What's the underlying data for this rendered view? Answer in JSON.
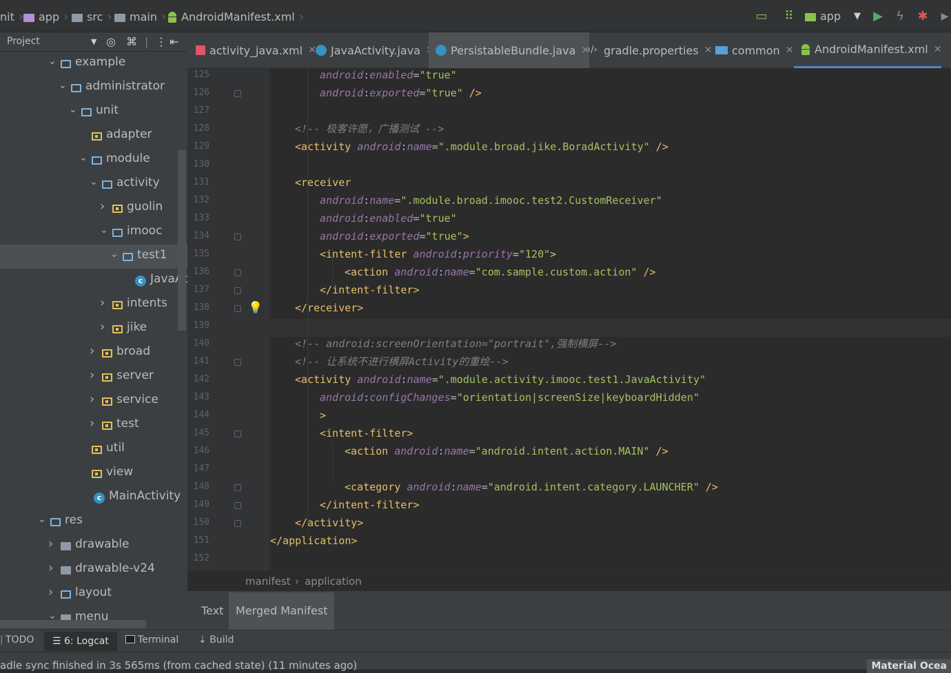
{
  "breadcrumbs": [
    "nit",
    "app",
    "src",
    "main",
    "AndroidManifest.xml"
  ],
  "toolbar": {
    "run_config": "app",
    "icons": [
      "sync-icon",
      "structure-icon",
      "run-config-icon",
      "dropdown-icon",
      "run-icon",
      "apply-changes-icon",
      "debug-icon",
      "attach-icon"
    ]
  },
  "project_panel": {
    "label": "Project",
    "tree": [
      {
        "label": "example",
        "depth": 0,
        "expanded": true,
        "kind": "folder"
      },
      {
        "label": "administrator",
        "depth": 1,
        "expanded": true,
        "kind": "folder"
      },
      {
        "label": "unit",
        "depth": 2,
        "expanded": true,
        "kind": "folder"
      },
      {
        "label": "adapter",
        "depth": 3,
        "expanded": null,
        "kind": "package"
      },
      {
        "label": "module",
        "depth": 3,
        "expanded": true,
        "kind": "folder"
      },
      {
        "label": "activity",
        "depth": 4,
        "expanded": true,
        "kind": "folder"
      },
      {
        "label": "guolin",
        "depth": 5,
        "expanded": false,
        "kind": "package"
      },
      {
        "label": "imooc",
        "depth": 5,
        "expanded": true,
        "kind": "folder"
      },
      {
        "label": "test1",
        "depth": 6,
        "expanded": true,
        "kind": "folder",
        "selected": true
      },
      {
        "label": "JavaAct",
        "depth": 7,
        "expanded": null,
        "kind": "class"
      },
      {
        "label": "intents",
        "depth": 5,
        "expanded": false,
        "kind": "package"
      },
      {
        "label": "jike",
        "depth": 5,
        "expanded": false,
        "kind": "package"
      },
      {
        "label": "broad",
        "depth": 4,
        "expanded": false,
        "kind": "package"
      },
      {
        "label": "server",
        "depth": 4,
        "expanded": false,
        "kind": "package"
      },
      {
        "label": "service",
        "depth": 4,
        "expanded": false,
        "kind": "package"
      },
      {
        "label": "test",
        "depth": 4,
        "expanded": false,
        "kind": "package"
      },
      {
        "label": "util",
        "depth": 3,
        "expanded": null,
        "kind": "package"
      },
      {
        "label": "view",
        "depth": 3,
        "expanded": null,
        "kind": "package"
      },
      {
        "label": "MainActivity",
        "depth": 3,
        "expanded": null,
        "kind": "class"
      },
      {
        "label": "res",
        "depth": -1,
        "expanded": true,
        "kind": "folder"
      },
      {
        "label": "drawable",
        "depth": 0,
        "expanded": false,
        "kind": "res"
      },
      {
        "label": "drawable-v24",
        "depth": 0,
        "expanded": false,
        "kind": "res"
      },
      {
        "label": "layout",
        "depth": 0,
        "expanded": false,
        "kind": "folder"
      },
      {
        "label": "menu",
        "depth": 0,
        "expanded": true,
        "kind": "res"
      }
    ]
  },
  "tabs": [
    {
      "label": "activity_java.xml",
      "icon": "xml-layout-icon"
    },
    {
      "label": "JavaActivity.java",
      "icon": "class-icon"
    },
    {
      "label": "PersistableBundle.java",
      "icon": "class-icon",
      "active": true
    },
    {
      "label": "gradle.properties",
      "icon": "properties-icon"
    },
    {
      "label": "common",
      "icon": "module-icon"
    },
    {
      "label": "AndroidManifest.xml",
      "icon": "android-icon",
      "current": true
    }
  ],
  "editor": {
    "lines": [
      {
        "n": "125",
        "indent": 2,
        "tokens": [
          [
            "ns",
            "android"
          ],
          [
            "attr",
            ":"
          ],
          [
            "ns",
            "enabled"
          ],
          [
            "attr",
            "="
          ],
          [
            "str",
            "\"true\""
          ]
        ]
      },
      {
        "n": "126",
        "indent": 2,
        "tokens": [
          [
            "ns",
            "android"
          ],
          [
            "attr",
            ":"
          ],
          [
            "ns",
            "exported"
          ],
          [
            "attr",
            "="
          ],
          [
            "str",
            "\"true\""
          ],
          [
            "plain",
            " "
          ],
          [
            "tag",
            "/>"
          ]
        ]
      },
      {
        "n": "127",
        "indent": 0,
        "tokens": []
      },
      {
        "n": "128",
        "indent": 1,
        "tokens": [
          [
            "com",
            "<!-- 极客许愿，广播测试 -->"
          ]
        ]
      },
      {
        "n": "129",
        "indent": 1,
        "tokens": [
          [
            "tag",
            "<activity "
          ],
          [
            "ns",
            "android"
          ],
          [
            "attr",
            ":"
          ],
          [
            "ns",
            "name"
          ],
          [
            "attr",
            "="
          ],
          [
            "str",
            "\".module.broad.jike.BoradActivity\""
          ],
          [
            "plain",
            " "
          ],
          [
            "tag",
            "/>"
          ]
        ]
      },
      {
        "n": "130",
        "indent": 0,
        "tokens": []
      },
      {
        "n": "131",
        "indent": 1,
        "tokens": [
          [
            "tag",
            "<receiver"
          ]
        ]
      },
      {
        "n": "132",
        "indent": 2,
        "tokens": [
          [
            "ns",
            "android"
          ],
          [
            "attr",
            ":"
          ],
          [
            "ns",
            "name"
          ],
          [
            "attr",
            "="
          ],
          [
            "str",
            "\".module.broad.imooc.test2.CustomReceiver\""
          ]
        ]
      },
      {
        "n": "133",
        "indent": 2,
        "tokens": [
          [
            "ns",
            "android"
          ],
          [
            "attr",
            ":"
          ],
          [
            "ns",
            "enabled"
          ],
          [
            "attr",
            "="
          ],
          [
            "str",
            "\"true\""
          ]
        ]
      },
      {
        "n": "134",
        "indent": 2,
        "tokens": [
          [
            "ns",
            "android"
          ],
          [
            "attr",
            ":"
          ],
          [
            "ns",
            "exported"
          ],
          [
            "attr",
            "="
          ],
          [
            "str",
            "\"true\""
          ],
          [
            "tag",
            ">"
          ]
        ]
      },
      {
        "n": "135",
        "indent": 2,
        "tokens": [
          [
            "tag",
            "<intent-filter "
          ],
          [
            "ns",
            "android"
          ],
          [
            "attr",
            ":"
          ],
          [
            "ns",
            "priority"
          ],
          [
            "attr",
            "="
          ],
          [
            "str",
            "\"120\""
          ],
          [
            "tag",
            ">"
          ]
        ]
      },
      {
        "n": "136",
        "indent": 3,
        "tokens": [
          [
            "tag",
            "<action "
          ],
          [
            "ns",
            "android"
          ],
          [
            "attr",
            ":"
          ],
          [
            "ns",
            "name"
          ],
          [
            "attr",
            "="
          ],
          [
            "str",
            "\"com.sample.custom.action\""
          ],
          [
            "plain",
            " "
          ],
          [
            "tag",
            "/>"
          ]
        ]
      },
      {
        "n": "137",
        "indent": 2,
        "tokens": [
          [
            "tag",
            "</intent-filter>"
          ]
        ]
      },
      {
        "n": "138",
        "indent": 1,
        "tokens": [
          [
            "tag",
            "</receiver>"
          ]
        ]
      },
      {
        "n": "139",
        "indent": 0,
        "tokens": [],
        "current": true
      },
      {
        "n": "140",
        "indent": 1,
        "tokens": [
          [
            "com",
            "<!-- android:screenOrientation=\"portrait\",强制横屏-->"
          ]
        ]
      },
      {
        "n": "141",
        "indent": 1,
        "tokens": [
          [
            "com",
            "<!-- 让系统不进行横屏Activity的重绘-->"
          ]
        ]
      },
      {
        "n": "142",
        "indent": 1,
        "tokens": [
          [
            "tag",
            "<activity "
          ],
          [
            "ns",
            "android"
          ],
          [
            "attr",
            ":"
          ],
          [
            "ns",
            "name"
          ],
          [
            "attr",
            "="
          ],
          [
            "str",
            "\".module.activity.imooc.test1.JavaActivity\""
          ]
        ]
      },
      {
        "n": "143",
        "indent": 2,
        "tokens": [
          [
            "ns",
            "android"
          ],
          [
            "attr",
            ":"
          ],
          [
            "ns",
            "configChanges"
          ],
          [
            "attr",
            "="
          ],
          [
            "str",
            "\"orientation|screenSize|keyboardHidden\""
          ]
        ]
      },
      {
        "n": "144",
        "indent": 2,
        "tokens": [
          [
            "tag",
            ">"
          ]
        ]
      },
      {
        "n": "145",
        "indent": 2,
        "tokens": [
          [
            "tag",
            "<intent-filter>"
          ]
        ]
      },
      {
        "n": "146",
        "indent": 3,
        "tokens": [
          [
            "tag",
            "<action "
          ],
          [
            "ns",
            "android"
          ],
          [
            "attr",
            ":"
          ],
          [
            "ns",
            "name"
          ],
          [
            "attr",
            "="
          ],
          [
            "str",
            "\"android.intent.action.MAIN\""
          ],
          [
            "plain",
            " "
          ],
          [
            "tag",
            "/>"
          ]
        ]
      },
      {
        "n": "147",
        "indent": 0,
        "tokens": []
      },
      {
        "n": "148",
        "indent": 3,
        "tokens": [
          [
            "tag",
            "<category "
          ],
          [
            "ns",
            "android"
          ],
          [
            "attr",
            ":"
          ],
          [
            "ns",
            "name"
          ],
          [
            "attr",
            "="
          ],
          [
            "str",
            "\"android.intent.category.LAUNCHER\""
          ],
          [
            "plain",
            " "
          ],
          [
            "tag",
            "/>"
          ]
        ]
      },
      {
        "n": "149",
        "indent": 2,
        "tokens": [
          [
            "tag",
            "</intent-filter>"
          ]
        ]
      },
      {
        "n": "150",
        "indent": 1,
        "tokens": [
          [
            "tag",
            "</activity>"
          ]
        ]
      },
      {
        "n": "151",
        "indent": 0,
        "tokens": [
          [
            "tag",
            "</application>"
          ]
        ]
      },
      {
        "n": "152",
        "indent": 0,
        "tokens": []
      }
    ]
  },
  "editor_breadcrumb": [
    "manifest",
    "application"
  ],
  "editor_tabs": [
    {
      "label": "Text"
    },
    {
      "label": "Merged Manifest",
      "active": true
    }
  ],
  "tool_windows": [
    {
      "label": "TODO"
    },
    {
      "label": "6: Logcat",
      "selected": true
    },
    {
      "label": "Terminal"
    },
    {
      "label": "Build"
    }
  ],
  "status": {
    "message": "adle sync finished in 3s 565ms (from cached state) (11 minutes ago)",
    "theme": "Material Ocea"
  }
}
